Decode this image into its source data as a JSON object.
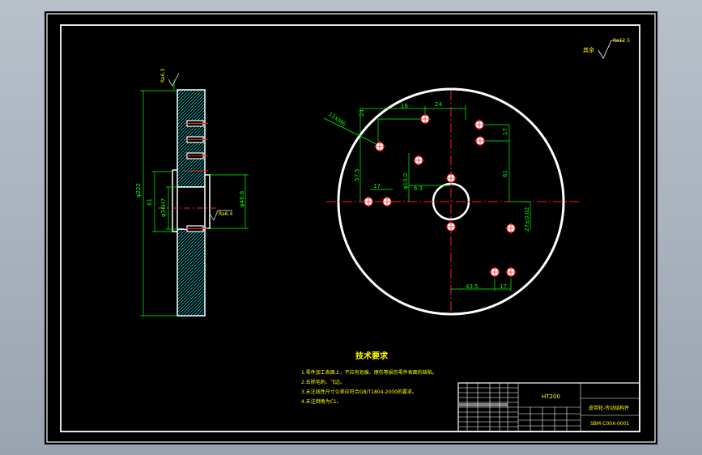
{
  "drawing": {
    "surface_roughness_note": "其余",
    "surface_roughness_value": "Ra12.5",
    "side_view": {
      "roughness_top": "Ra6.3",
      "roughness_bore": "Ra6.4",
      "dim_outer_diameter": "φ222",
      "dim_61": "61",
      "dim_inner": "φ36H7",
      "dim_hub": "φ46.8"
    },
    "front_view": {
      "thread_callout": "12XM6",
      "dims": [
        "24",
        "16",
        "24",
        "17",
        "61",
        "17",
        "57.5",
        "φ10.0",
        "6.3",
        "27±0.02",
        "43.5",
        "17"
      ]
    }
  },
  "notes": {
    "title": "技术要求",
    "items": [
      "1.零件加工表面上，不应有划痕、擦伤等损伤零件表面的缺陷。",
      "2.去除毛刺、飞边。",
      "3.未注线性尺寸公差应符合GB/T1804-2000的要求。",
      "4.未注倒角为C1。"
    ]
  },
  "title_block": {
    "material": "HT200",
    "part_name": "皮带轮-传动结构件",
    "drawing_number": "SBM-C00X-0001"
  },
  "colors": {
    "outline": "#ffffff",
    "dimension": "#00ff00",
    "centerline": "#ff0000",
    "hatch": "#00ffff",
    "annotation": "#ffff00"
  }
}
